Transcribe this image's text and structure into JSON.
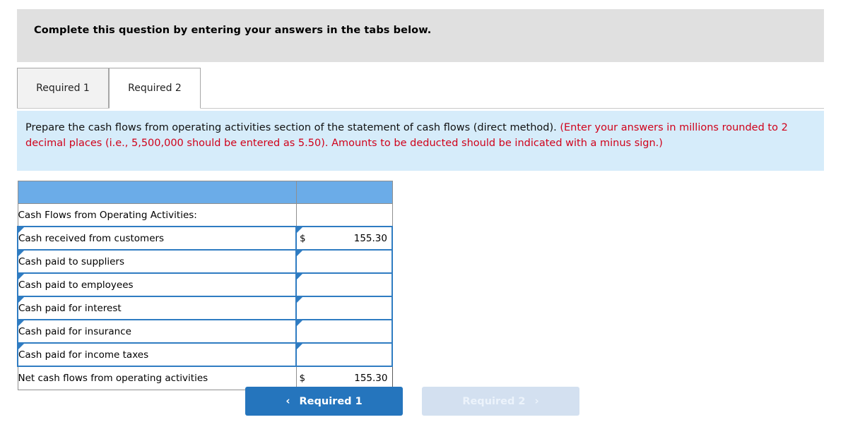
{
  "banner": {
    "title": "Complete this question by entering your answers in the tabs below."
  },
  "tabs": [
    {
      "label": "Required 1",
      "active": false
    },
    {
      "label": "Required 2",
      "active": true
    }
  ],
  "instructions": {
    "lead": "Prepare the cash flows from operating activities section of the statement of cash flows (direct method). ",
    "note": "(Enter your answers in millions rounded to 2 decimal places (i.e., 5,500,000 should be entered as 5.50). Amounts to be deducted should be indicated with a minus sign.)"
  },
  "table": {
    "header_label": "",
    "header_value": "",
    "section_title": "Cash Flows from Operating Activities:",
    "rows": [
      {
        "label": "Cash received from customers",
        "symbol": "$",
        "amount": "155.30",
        "editable": true
      },
      {
        "label": "Cash paid to suppliers",
        "symbol": "",
        "amount": "",
        "editable": true
      },
      {
        "label": "Cash paid to employees",
        "symbol": "",
        "amount": "",
        "editable": true
      },
      {
        "label": "Cash paid for interest",
        "symbol": "",
        "amount": "",
        "editable": true
      },
      {
        "label": "Cash paid for insurance",
        "symbol": "",
        "amount": "",
        "editable": true
      },
      {
        "label": "Cash paid for income taxes",
        "symbol": "",
        "amount": "",
        "editable": true
      }
    ],
    "total": {
      "label": "Net cash flows from operating activities",
      "symbol": "$",
      "amount": "155.30"
    }
  },
  "nav": {
    "prev": {
      "label": "Required 1",
      "chevron": "‹"
    },
    "next": {
      "label": "Required 2",
      "chevron": "›"
    }
  },
  "colors": {
    "banner_bg": "#e0e0e0",
    "instruction_bg": "#d6ecfa",
    "note_text": "#d0021b",
    "table_header_blue": "#6bace8",
    "input_border_blue": "#2f7cc2",
    "primary_button": "#2575bd",
    "disabled_button": "#d3e0f0"
  }
}
